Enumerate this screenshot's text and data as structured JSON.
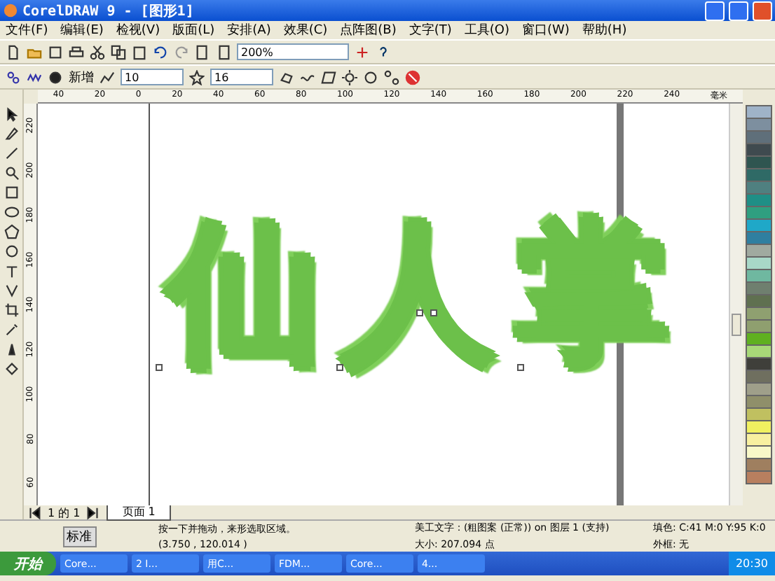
{
  "window": {
    "title": "CorelDRAW 9 - [图形1]"
  },
  "menu": [
    "文件(F)",
    "编辑(E)",
    "检视(V)",
    "版面(L)",
    "安排(A)",
    "效果(C)",
    "点阵图(B)",
    "文字(T)",
    "工具(O)",
    "窗口(W)",
    "帮助(H)"
  ],
  "toolbar": {
    "zoom": "200%"
  },
  "property_bar": {
    "label": "新增",
    "detail": "10",
    "size": "16"
  },
  "ruler": {
    "top_labels": [
      "40",
      "20",
      "0",
      "20",
      "40",
      "60",
      "80",
      "100",
      "120",
      "140",
      "160",
      "180",
      "200",
      "220",
      "240"
    ],
    "unit": "毫米",
    "left_labels": [
      "220",
      "200",
      "180",
      "160",
      "140",
      "120",
      "100",
      "80",
      "60"
    ]
  },
  "canvas": {
    "art_text": "仙人掌"
  },
  "page_nav": {
    "counter": "1 的 1",
    "tab": "页面 1"
  },
  "palette": [
    {
      "color": "#9fb3c8"
    },
    {
      "color": "#7d8f9f"
    },
    {
      "color": "#5f6f7a"
    },
    {
      "color": "#3f4a4f"
    },
    {
      "color": "#2f5550"
    },
    {
      "color": "#2f6a66"
    },
    {
      "color": "#4f8080"
    },
    {
      "color": "#1f8f86"
    },
    {
      "color": "#2f9f80"
    },
    {
      "color": "#1fa8c8"
    },
    {
      "color": "#2f7fa0"
    },
    {
      "color": "#a0aaa0"
    },
    {
      "color": "#a8d8c8"
    },
    {
      "color": "#6fb8a0"
    },
    {
      "color": "#6f7f6f"
    },
    {
      "color": "#5f7050"
    },
    {
      "color": "#8fa070"
    },
    {
      "color": "#8f9f6f"
    },
    {
      "color": "#5fb020"
    },
    {
      "color": "#a8d878"
    },
    {
      "color": "#3f3f3a"
    },
    {
      "color": "#6f6f5f"
    },
    {
      "color": "#9f9f8a"
    },
    {
      "color": "#8f8f6a"
    },
    {
      "color": "#c0c060"
    },
    {
      "color": "#f0f060"
    },
    {
      "color": "#f8f0a0"
    },
    {
      "color": "#f8f8c8"
    },
    {
      "color": "#9f7f5f"
    },
    {
      "color": "#b87f5f"
    }
  ],
  "status_bar": {
    "mode": "标准",
    "message": "按一下并拖动，来形选取区域。",
    "object": "美工文字：(粗图案 (正常)) on 图层 1 (支持)",
    "coords": "(3.750 , 120.014 )",
    "size": "大小: 207.094 点",
    "fill": "填色: C:41 M:0 Y:95 K:0",
    "outline": "外框: 无"
  },
  "taskbar": {
    "start": "开始",
    "buttons": [
      "Core...",
      "2 I...",
      "用C...",
      "FDM...",
      "Core...",
      "4..."
    ],
    "clock": "20:30"
  }
}
